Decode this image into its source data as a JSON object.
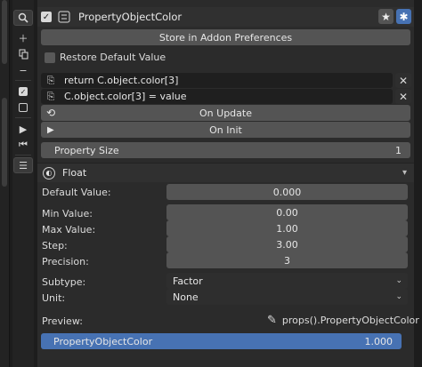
{
  "header": {
    "title": "PropertyObjectColor",
    "node_icon": "node-icon",
    "star_icon": "star-icon",
    "gear_icon": "gear-icon"
  },
  "toolbar": {
    "icons": [
      "search-icon",
      "add-icon",
      "duplicate-icon",
      "remove-icon",
      "checkbox-icon",
      "empty-checkbox-icon",
      "play-icon",
      "step-icon",
      "menu-icon"
    ]
  },
  "addon": {
    "store_label": "Store in Addon Preferences",
    "restore_label": "Restore Default Value"
  },
  "getter": {
    "return_text": "return C.object.color[3]",
    "setter_text": "C.object.color[3] = value"
  },
  "events": {
    "on_update": "On Update",
    "on_init": "On Init"
  },
  "property_size": {
    "label": "Property Size",
    "value": "1"
  },
  "type_panel": {
    "label": "Float"
  },
  "values": {
    "default_label": "Default Value:",
    "default_value": "0.000",
    "min_label": "Min Value:",
    "min_value": "0.00",
    "max_label": "Max Value:",
    "max_value": "1.00",
    "step_label": "Step:",
    "step_value": "3.00",
    "precision_label": "Precision:",
    "precision_value": "3"
  },
  "options": {
    "subtype_label": "Subtype:",
    "subtype_value": "Factor",
    "unit_label": "Unit:",
    "unit_value": "None"
  },
  "preview": {
    "label": "Preview:",
    "path": "props().PropertyObjectColor",
    "bar_label": "PropertyObjectColor",
    "bar_value": "1.000",
    "bar_fill": 1.0
  },
  "colors": {
    "accent": "#4772b3",
    "panel": "#2b2b2b",
    "field": "#545454"
  }
}
